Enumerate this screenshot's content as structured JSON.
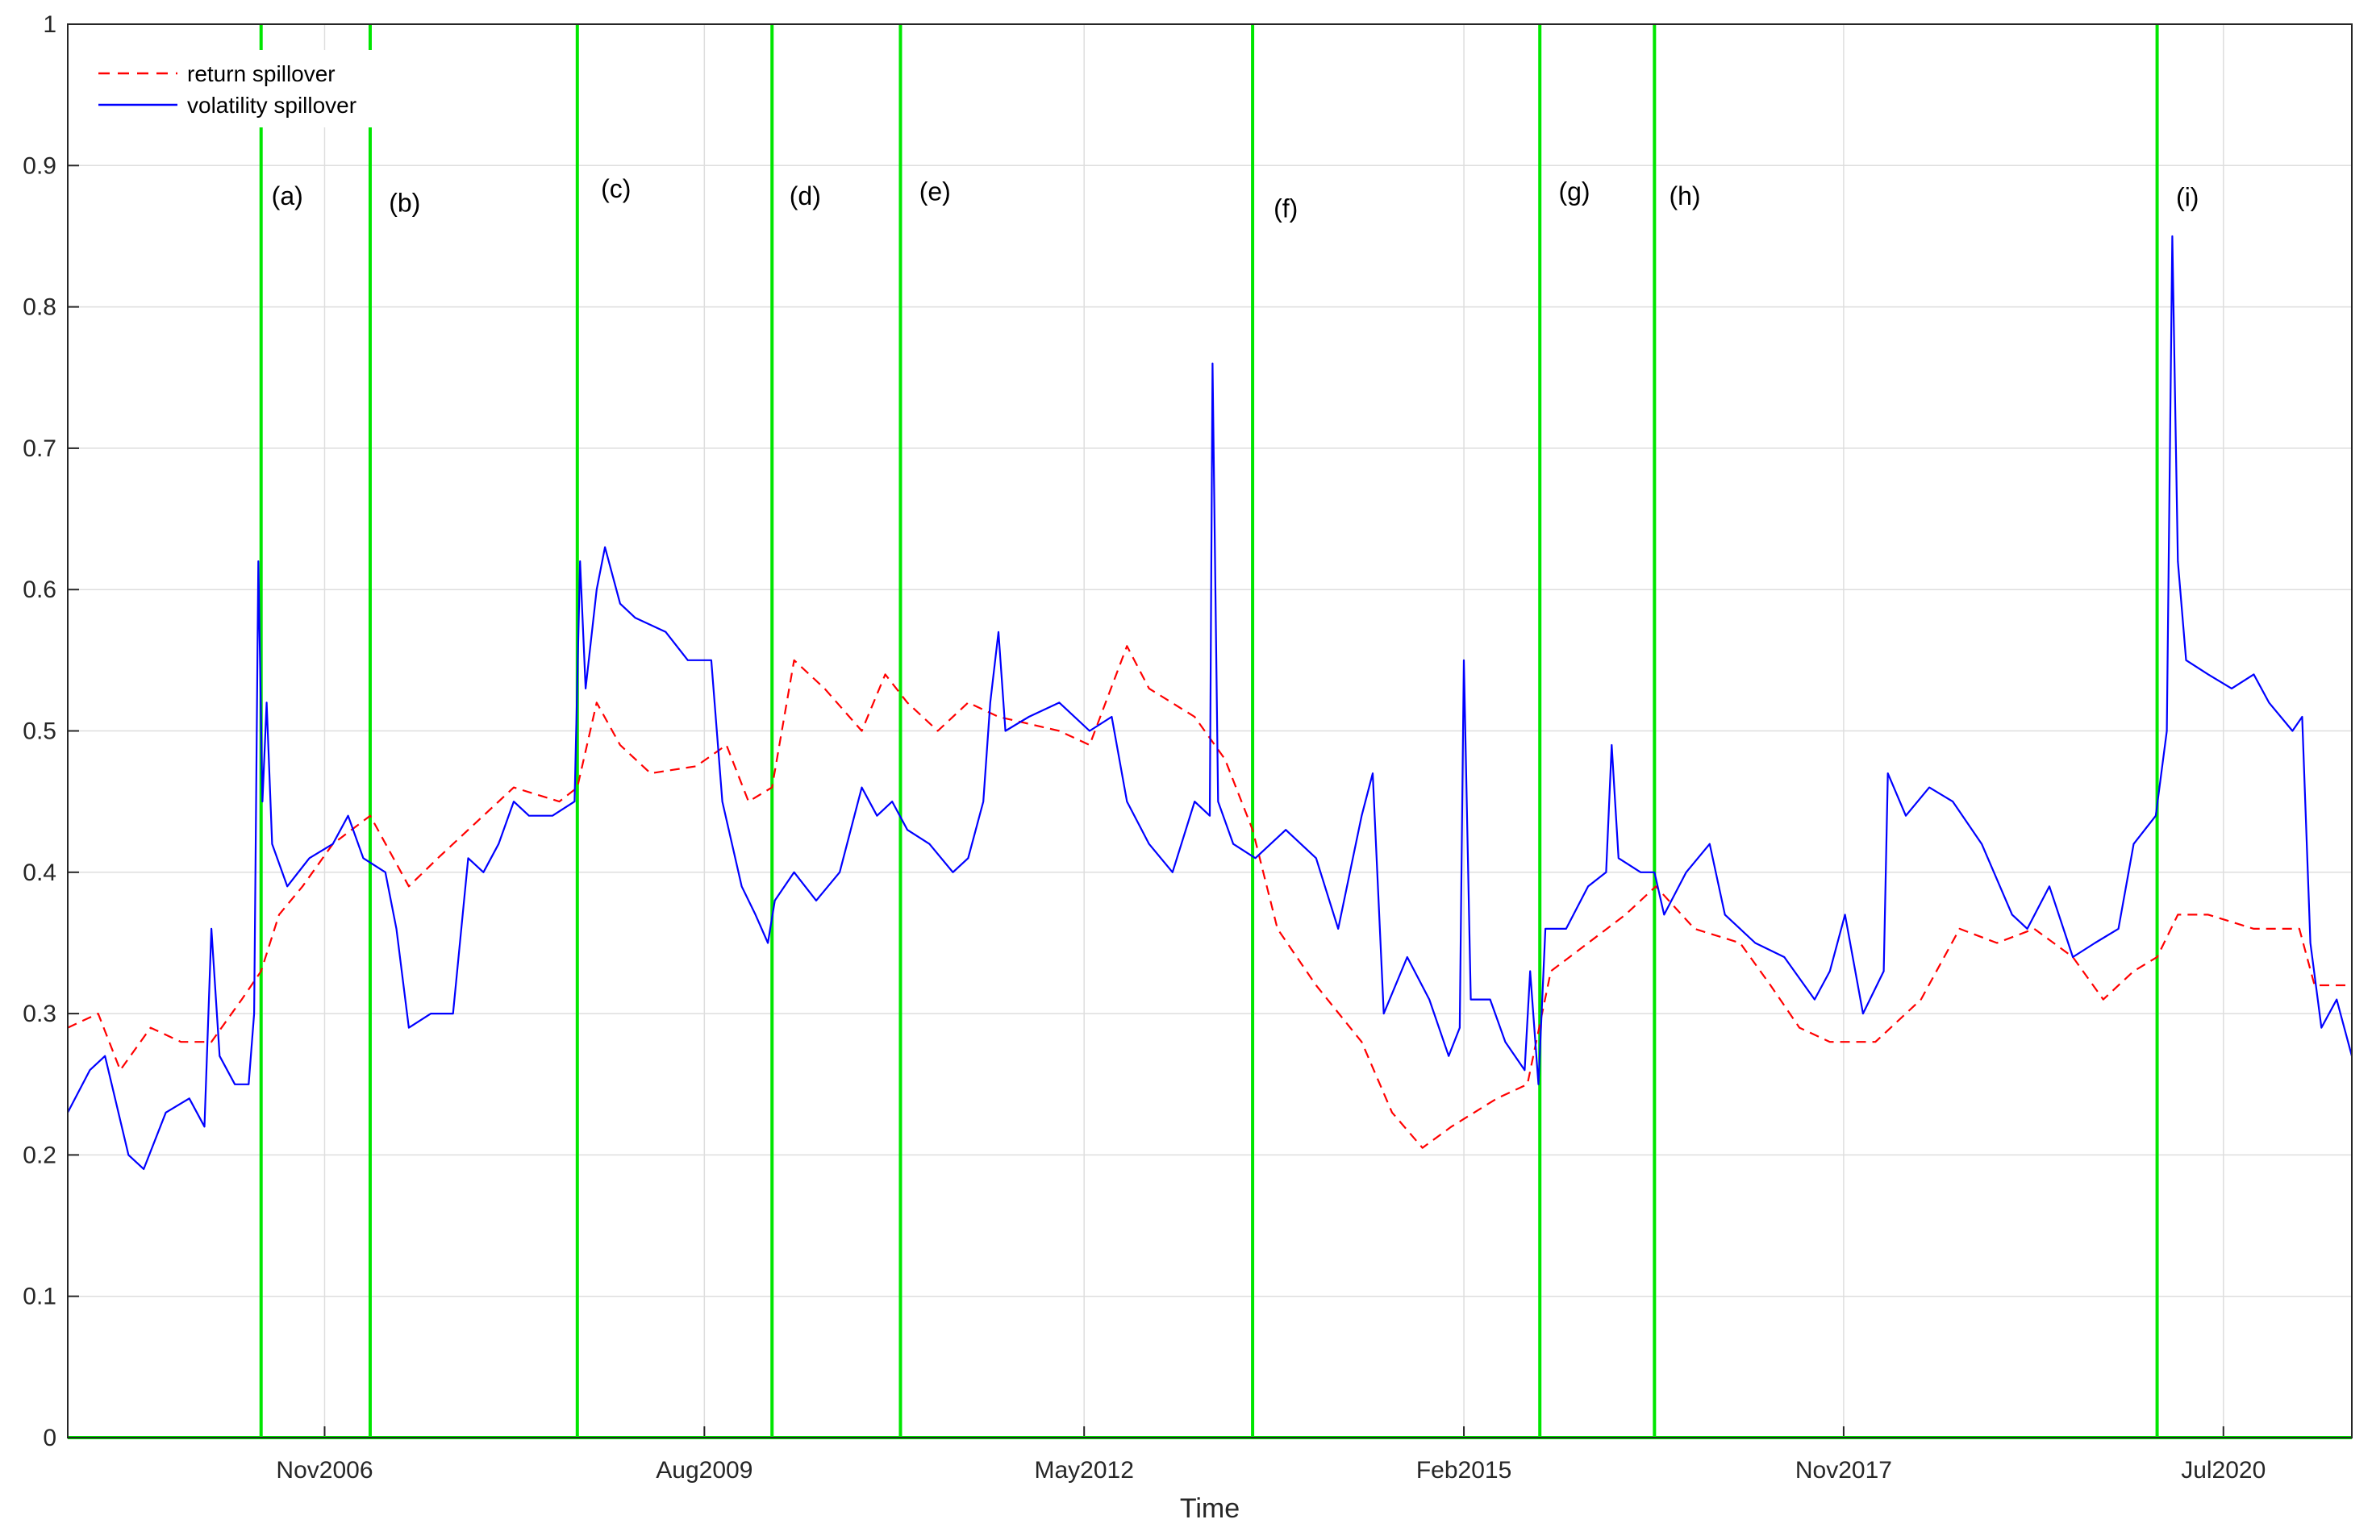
{
  "chart_data": {
    "type": "line",
    "title": "",
    "xlabel": "Time",
    "ylabel": "",
    "xlim": [
      2004.97,
      2021.51
    ],
    "ylim": [
      0,
      1
    ],
    "grid": true,
    "legend_position": "top-left",
    "xticks": [
      {
        "value": 2006.83,
        "label": "Nov2006"
      },
      {
        "value": 2009.58,
        "label": "Aug2009"
      },
      {
        "value": 2012.33,
        "label": "May2012"
      },
      {
        "value": 2015.08,
        "label": "Feb2015"
      },
      {
        "value": 2017.83,
        "label": "Nov2017"
      },
      {
        "value": 2020.58,
        "label": "Jul2020"
      }
    ],
    "yticks": [
      {
        "value": 0,
        "label": "0"
      },
      {
        "value": 0.1,
        "label": "0.1"
      },
      {
        "value": 0.2,
        "label": "0.2"
      },
      {
        "value": 0.3,
        "label": "0.3"
      },
      {
        "value": 0.4,
        "label": "0.4"
      },
      {
        "value": 0.5,
        "label": "0.5"
      },
      {
        "value": 0.6,
        "label": "0.6"
      },
      {
        "value": 0.7,
        "label": "0.7"
      },
      {
        "value": 0.8,
        "label": "0.8"
      },
      {
        "value": 0.9,
        "label": "0.9"
      },
      {
        "value": 1,
        "label": "1"
      }
    ],
    "series": [
      {
        "name": "return spillover",
        "color": "#ff0000",
        "style": "dashed",
        "x": [
          2004.97,
          2005.19,
          2005.35,
          2005.57,
          2005.79,
          2006.01,
          2006.23,
          2006.37,
          2006.5,
          2006.67,
          2006.89,
          2007.16,
          2007.44,
          2007.65,
          2007.87,
          2008.2,
          2008.53,
          2008.66,
          2008.8,
          2008.97,
          2009.19,
          2009.52,
          2009.74,
          2009.9,
          2010.07,
          2010.23,
          2010.45,
          2010.72,
          2010.89,
          2011.05,
          2011.27,
          2011.49,
          2011.71,
          2012.15,
          2012.37,
          2012.64,
          2012.8,
          2013.13,
          2013.35,
          2013.55,
          2013.73,
          2014.01,
          2014.34,
          2014.56,
          2014.78,
          2014.99,
          2015.32,
          2015.54,
          2015.71,
          2015.98,
          2016.25,
          2016.47,
          2016.75,
          2017.08,
          2017.3,
          2017.51,
          2017.73,
          2018.06,
          2018.39,
          2018.67,
          2018.94,
          2019.21,
          2019.49,
          2019.71,
          2019.93,
          2020.1,
          2020.25,
          2020.47,
          2020.8,
          2021.13,
          2021.24,
          2021.51
        ],
        "y": [
          0.29,
          0.3,
          0.26,
          0.29,
          0.28,
          0.28,
          0.31,
          0.33,
          0.37,
          0.39,
          0.42,
          0.44,
          0.39,
          0.41,
          0.43,
          0.46,
          0.45,
          0.46,
          0.52,
          0.49,
          0.47,
          0.475,
          0.49,
          0.45,
          0.46,
          0.55,
          0.53,
          0.5,
          0.54,
          0.52,
          0.5,
          0.52,
          0.51,
          0.5,
          0.49,
          0.56,
          0.53,
          0.51,
          0.48,
          0.43,
          0.36,
          0.32,
          0.28,
          0.23,
          0.205,
          0.22,
          0.24,
          0.25,
          0.33,
          0.35,
          0.37,
          0.39,
          0.36,
          0.35,
          0.32,
          0.29,
          0.28,
          0.28,
          0.31,
          0.36,
          0.35,
          0.36,
          0.34,
          0.31,
          0.33,
          0.34,
          0.37,
          0.37,
          0.36,
          0.36,
          0.32,
          0.32
        ]
      },
      {
        "name": "volatility spillover",
        "color": "#0000ff",
        "style": "solid",
        "x": [
          2004.97,
          2005.13,
          2005.24,
          2005.41,
          2005.52,
          2005.68,
          2005.85,
          2005.96,
          2006.01,
          2006.07,
          2006.18,
          2006.28,
          2006.32,
          2006.35,
          2006.38,
          2006.41,
          2006.45,
          2006.56,
          2006.72,
          2006.89,
          2007.0,
          2007.11,
          2007.27,
          2007.35,
          2007.44,
          2007.6,
          2007.76,
          2007.87,
          2007.98,
          2008.09,
          2008.2,
          2008.31,
          2008.48,
          2008.64,
          2008.68,
          2008.72,
          2008.8,
          2008.86,
          2008.97,
          2009.08,
          2009.3,
          2009.46,
          2009.63,
          2009.71,
          2009.85,
          2009.95,
          2010.04,
          2010.09,
          2010.23,
          2010.39,
          2010.56,
          2010.72,
          2010.83,
          2010.94,
          2011.05,
          2011.21,
          2011.38,
          2011.49,
          2011.6,
          2011.65,
          2011.71,
          2011.76,
          2011.93,
          2012.15,
          2012.37,
          2012.53,
          2012.64,
          2012.8,
          2012.97,
          2013.13,
          2013.24,
          2013.26,
          2013.3,
          2013.41,
          2013.57,
          2013.79,
          2014.01,
          2014.17,
          2014.34,
          2014.42,
          2014.5,
          2014.67,
          2014.83,
          2014.97,
          2015.05,
          2015.08,
          2015.13,
          2015.27,
          2015.38,
          2015.52,
          2015.56,
          2015.62,
          2015.67,
          2015.82,
          2015.98,
          2016.11,
          2016.15,
          2016.2,
          2016.36,
          2016.46,
          2016.53,
          2016.69,
          2016.86,
          2016.97,
          2017.19,
          2017.4,
          2017.62,
          2017.73,
          2017.84,
          2017.97,
          2018.12,
          2018.15,
          2018.28,
          2018.45,
          2018.62,
          2018.83,
          2019.05,
          2019.16,
          2019.32,
          2019.49,
          2019.65,
          2019.82,
          2019.93,
          2020.09,
          2020.17,
          2020.21,
          2020.25,
          2020.31,
          2020.47,
          2020.64,
          2020.8,
          2020.91,
          2021.08,
          2021.15,
          2021.21,
          2021.29,
          2021.4,
          2021.51
        ],
        "y": [
          0.23,
          0.26,
          0.27,
          0.2,
          0.19,
          0.23,
          0.24,
          0.22,
          0.36,
          0.27,
          0.25,
          0.25,
          0.3,
          0.62,
          0.45,
          0.52,
          0.42,
          0.39,
          0.41,
          0.42,
          0.44,
          0.41,
          0.4,
          0.36,
          0.29,
          0.3,
          0.3,
          0.41,
          0.4,
          0.42,
          0.45,
          0.44,
          0.44,
          0.45,
          0.62,
          0.53,
          0.6,
          0.63,
          0.59,
          0.58,
          0.57,
          0.55,
          0.55,
          0.45,
          0.39,
          0.37,
          0.35,
          0.38,
          0.4,
          0.38,
          0.4,
          0.46,
          0.44,
          0.45,
          0.43,
          0.42,
          0.4,
          0.41,
          0.45,
          0.52,
          0.57,
          0.5,
          0.51,
          0.52,
          0.5,
          0.51,
          0.45,
          0.42,
          0.4,
          0.45,
          0.44,
          0.76,
          0.45,
          0.42,
          0.41,
          0.43,
          0.41,
          0.36,
          0.44,
          0.47,
          0.3,
          0.34,
          0.31,
          0.27,
          0.29,
          0.55,
          0.31,
          0.31,
          0.28,
          0.26,
          0.33,
          0.25,
          0.36,
          0.36,
          0.39,
          0.4,
          0.49,
          0.41,
          0.4,
          0.4,
          0.37,
          0.4,
          0.42,
          0.37,
          0.35,
          0.34,
          0.31,
          0.33,
          0.37,
          0.3,
          0.33,
          0.47,
          0.44,
          0.46,
          0.45,
          0.42,
          0.37,
          0.36,
          0.39,
          0.34,
          0.35,
          0.36,
          0.42,
          0.44,
          0.5,
          0.85,
          0.62,
          0.55,
          0.54,
          0.53,
          0.54,
          0.52,
          0.5,
          0.51,
          0.35,
          0.29,
          0.31,
          0.27
        ]
      }
    ],
    "event_lines": {
      "color": "#00e600",
      "events": [
        {
          "x": 2006.37,
          "label": "(a)",
          "label_x": 2006.56,
          "label_y": 0.878
        },
        {
          "x": 2007.16,
          "label": "(b)",
          "label_x": 2007.41,
          "label_y": 0.873
        },
        {
          "x": 2008.66,
          "label": "(c)",
          "label_x": 2008.94,
          "label_y": 0.883
        },
        {
          "x": 2010.07,
          "label": "(d)",
          "label_x": 2010.31,
          "label_y": 0.878
        },
        {
          "x": 2011.0,
          "label": "(e)",
          "label_x": 2011.25,
          "label_y": 0.881
        },
        {
          "x": 2013.55,
          "label": "(f)",
          "label_x": 2013.79,
          "label_y": 0.869
        },
        {
          "x": 2015.63,
          "label": "(g)",
          "label_x": 2015.88,
          "label_y": 0.881
        },
        {
          "x": 2016.46,
          "label": "(h)",
          "label_x": 2016.68,
          "label_y": 0.878
        },
        {
          "x": 2020.1,
          "label": "(i)",
          "label_x": 2020.32,
          "label_y": 0.877
        }
      ]
    }
  }
}
